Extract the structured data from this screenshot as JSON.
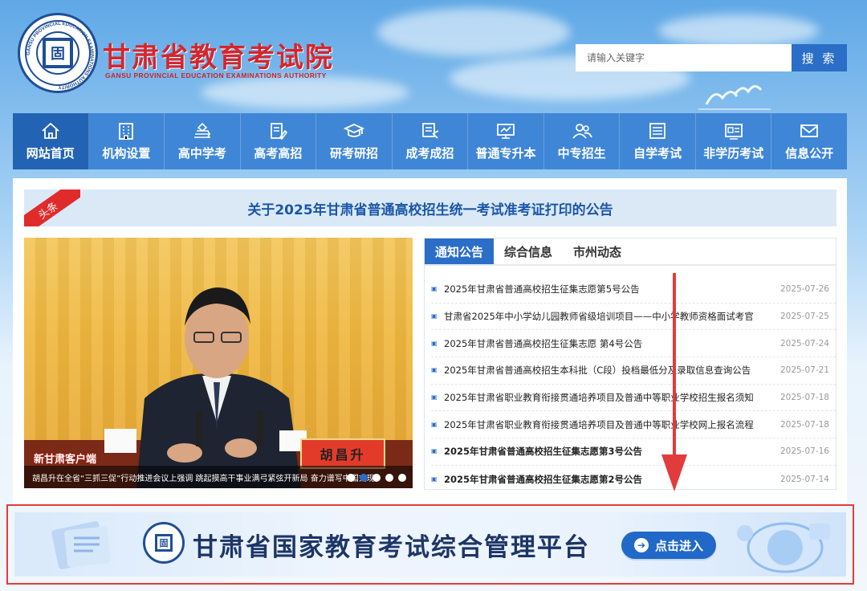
{
  "header": {
    "title": "甘肃省教育考试院",
    "subtitle": "GANSU PROVINCIAL EDUCATION EXAMINATIONS AUTHORITY",
    "seal_text": "GANSU PROVINCIAL EDUCATION EXAMINATIONS AUTHORITY",
    "seal_char": "固"
  },
  "search": {
    "placeholder": "请输入关键字",
    "button_label": "搜 索"
  },
  "nav": {
    "items": [
      {
        "label": "网站首页",
        "icon": "home-icon"
      },
      {
        "label": "机构设置",
        "icon": "building-icon"
      },
      {
        "label": "高中学考",
        "icon": "book-stack-icon"
      },
      {
        "label": "高考高招",
        "icon": "document-pen-icon"
      },
      {
        "label": "研考研招",
        "icon": "graduation-cap-icon"
      },
      {
        "label": "成考成招",
        "icon": "chalkboard-icon"
      },
      {
        "label": "普通专升本",
        "icon": "monitor-board-icon"
      },
      {
        "label": "中专招生",
        "icon": "users-icon"
      },
      {
        "label": "自学考试",
        "icon": "newspaper-icon"
      },
      {
        "label": "非学历考试",
        "icon": "id-card-icon"
      },
      {
        "label": "信息公开",
        "icon": "mail-icon"
      }
    ],
    "active_index": 0
  },
  "headline": {
    "tag": "头条",
    "title": "关于2025年甘肃省普通高校招生统一考试准考证打印的公告"
  },
  "slideshow": {
    "caption": "胡昌升在全省“三抓三促”行动推进会议上强调 跳起摸高干事业满弓紧弦开新局 奋力谱写中国式现",
    "watermark": "新甘肃客户端",
    "nameplate": "胡昌升",
    "dot_count": 5,
    "active_dot": 1
  },
  "news": {
    "tabs": [
      "通知公告",
      "综合信息",
      "市州动态"
    ],
    "active_tab": 0,
    "items": [
      {
        "title": "2025年甘肃省普通高校招生征集志愿第5号公告",
        "date": "2025-07-26",
        "bold": false
      },
      {
        "title": "甘肃省2025年中小学幼儿园教师省级培训项目——中小学教师资格面试考官",
        "date": "2025-07-25",
        "bold": false
      },
      {
        "title": "2025年甘肃省普通高校招生征集志愿 第4号公告",
        "date": "2025-07-24",
        "bold": false
      },
      {
        "title": "2025年甘肃省普通高校招生本科批（C段）投档最低分及录取信息查询公告",
        "date": "2025-07-21",
        "bold": false
      },
      {
        "title": "2025年甘肃省职业教育衔接贯通培养项目及普通中等职业学校招生报名须知",
        "date": "2025-07-18",
        "bold": false
      },
      {
        "title": "2025年甘肃省职业教育衔接贯通培养项目及普通中等职业学校网上报名流程",
        "date": "2025-07-18",
        "bold": false
      },
      {
        "title": "2025年甘肃省普通高校招生征集志愿第3号公告",
        "date": "2025-07-16",
        "bold": true
      },
      {
        "title": "2025年甘肃省普通高校招生征集志愿第2号公告",
        "date": "2025-07-14",
        "bold": true
      }
    ]
  },
  "banner": {
    "title": "甘肃省国家教育考试综合管理平台",
    "button_label": "点击进入",
    "seal_char": "固"
  },
  "colors": {
    "nav_bg": "#3f86d6",
    "nav_active": "#2363b3",
    "title_red": "#d4262c",
    "headline_blue": "#1b57a8",
    "annotation_red": "#e03c3c"
  }
}
